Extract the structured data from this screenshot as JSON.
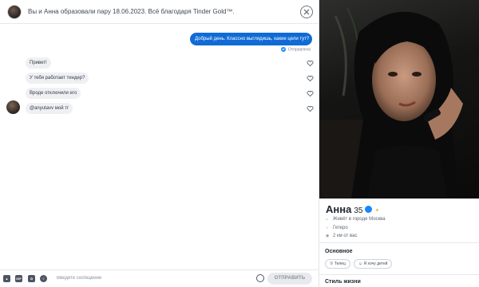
{
  "header": {
    "match_text": "Вы и Анна образовали пару 18.06.2023. Всё благодаря Tinder Gold™."
  },
  "messages": {
    "outgoing": {
      "text": "Добрый день. Классно выглядишь, какие цели тут?",
      "status": "Отправлено"
    },
    "incoming": [
      {
        "text": "Привет!"
      },
      {
        "text": "У тебя работает тиндер?"
      },
      {
        "text": "Вроде отключили его"
      },
      {
        "text": "@anyutavv мой тг"
      }
    ]
  },
  "composer": {
    "tools": [
      "image-icon",
      "gif",
      "sticker-icon",
      "music-icon"
    ],
    "gif_label": "GIF",
    "placeholder": "Введите сообщение",
    "send_label": "ОТПРАВИТЬ"
  },
  "profile": {
    "name": "Анна",
    "age": "35",
    "lives_in": "Живёт в городе Москва",
    "orientation": "Гетеро",
    "distance": "2 км от вас",
    "section_basic": "Основное",
    "chips": [
      "Телец",
      "Я хочу детей"
    ],
    "section_lifestyle": "Стиль жизни"
  },
  "colors": {
    "accent_blue": "#106bd5",
    "verified_blue": "#1786ff",
    "gold": "#e0b93a"
  }
}
